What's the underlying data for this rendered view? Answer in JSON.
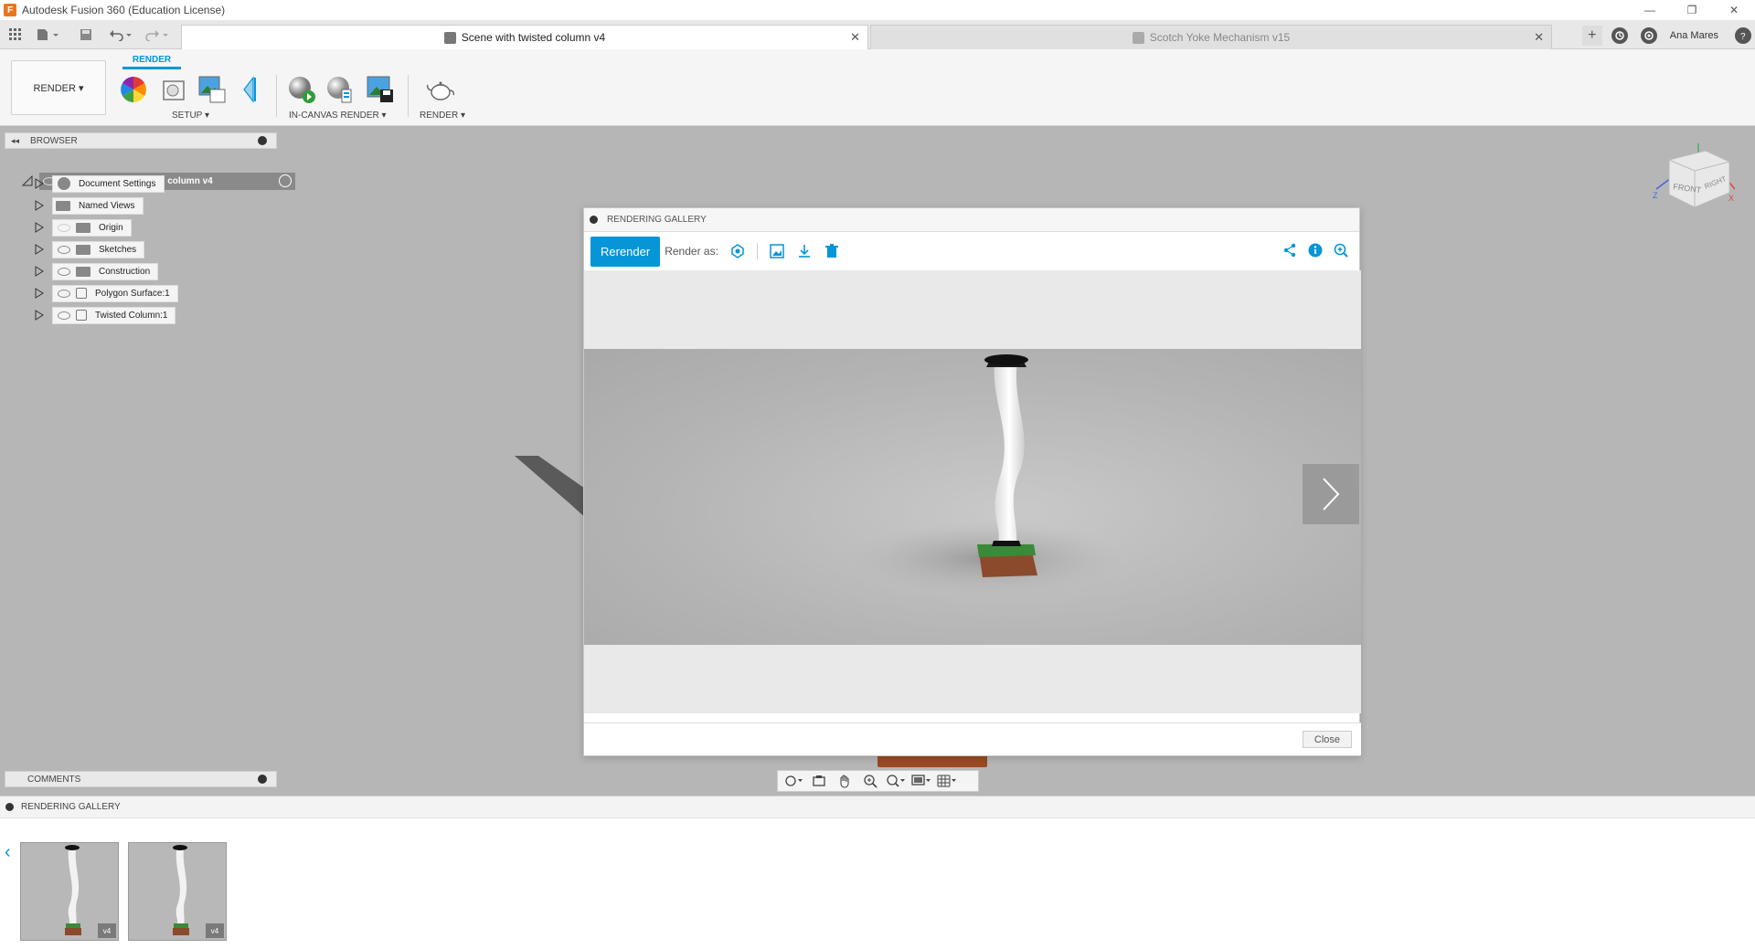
{
  "window": {
    "title": "Autodesk Fusion 360 (Education License)",
    "app_icon_letter": "F",
    "min_glyph": "—",
    "restore_glyph": "❐",
    "close_glyph": "✕"
  },
  "quick_access": {
    "grid_icon": "grid-icon",
    "file_icon": "file-icon",
    "save_icon": "save-icon",
    "undo_icon": "undo-icon",
    "redo_icon": "redo-icon"
  },
  "tabs": [
    {
      "label": "Scene with twisted column v4",
      "active": true,
      "close": "✕"
    },
    {
      "label": "Scotch Yoke Mechanism v15",
      "active": false,
      "close": "✕"
    }
  ],
  "user": {
    "name": "Ana Mares",
    "plus": "+"
  },
  "toolbar": {
    "workspace": "RENDER ▾",
    "workspace_tab": "RENDER",
    "groups": [
      {
        "label": "SETUP ▾"
      },
      {
        "label": "IN-CANVAS RENDER ▾"
      },
      {
        "label": "RENDER ▾"
      }
    ]
  },
  "browser": {
    "title": "BROWSER",
    "root": "Scene with twisted column v4",
    "items": [
      {
        "label": "Document Settings",
        "icon": "gear-icon",
        "eye": false
      },
      {
        "label": "Named Views",
        "icon": "folder-icon",
        "eye": false
      },
      {
        "label": "Origin",
        "icon": "folder-icon",
        "eye": "off"
      },
      {
        "label": "Sketches",
        "icon": "folder-icon",
        "eye": true
      },
      {
        "label": "Construction",
        "icon": "folder-icon",
        "eye": true
      },
      {
        "label": "Polygon Surface:1",
        "icon": "body-icon",
        "eye": true
      },
      {
        "label": "Twisted Column:1",
        "icon": "body-icon",
        "eye": true
      }
    ]
  },
  "comments": {
    "title": "COMMENTS"
  },
  "viewcube": {
    "front": "FRONT",
    "right": "RIGHT",
    "z": "Z",
    "x": "X"
  },
  "gallery_dialog": {
    "title": "RENDERING GALLERY",
    "rerender": "Rerender",
    "render_as": "Render as:",
    "close": "Close"
  },
  "bottom_gallery": {
    "title": "RENDERING GALLERY",
    "prev": "‹",
    "thumbnails": [
      {
        "badge": "v4"
      },
      {
        "badge": "v4"
      }
    ]
  },
  "colors": {
    "accent": "#0696d7",
    "wood": "#8b4a2b",
    "grass": "#3a8a3a"
  }
}
